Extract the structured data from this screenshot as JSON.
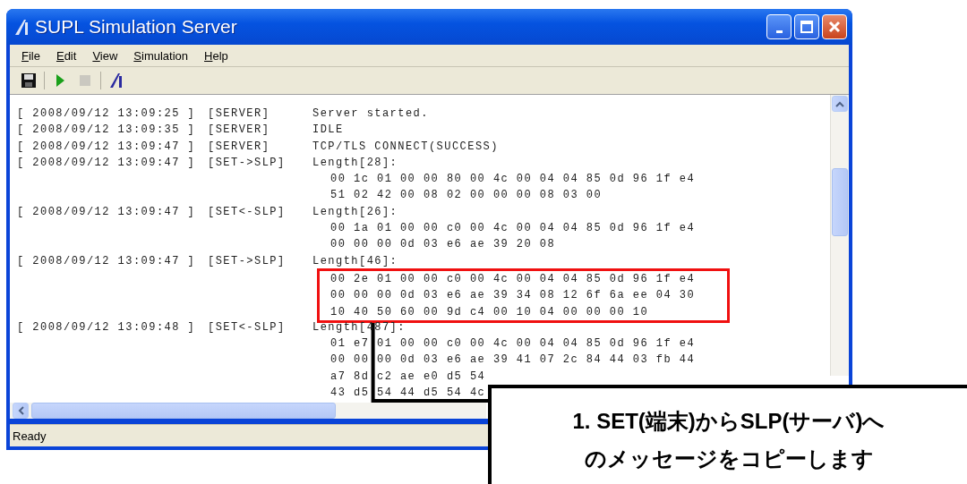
{
  "window": {
    "title": "SUPL Simulation Server"
  },
  "menu": [
    "File",
    "Edit",
    "View",
    "Simulation",
    "Help"
  ],
  "toolbar": [
    {
      "kind": "save",
      "disabled": false
    },
    {
      "kind": "separator"
    },
    {
      "kind": "play",
      "disabled": false
    },
    {
      "kind": "stop",
      "disabled": true
    },
    {
      "kind": "separator"
    },
    {
      "kind": "logo",
      "disabled": false
    }
  ],
  "log": [
    {
      "timestamp": "[ 2008/09/12 13:09:25 ]",
      "source": "[SERVER]",
      "message": "Server started."
    },
    {
      "timestamp": "[ 2008/09/12 13:09:35 ]",
      "source": "[SERVER]",
      "message": "IDLE"
    },
    {
      "timestamp": "[ 2008/09/12 13:09:47 ]",
      "source": "[SERVER]",
      "message": "TCP/TLS CONNECT(SUCCESS)"
    },
    {
      "timestamp": "[ 2008/09/12 13:09:47 ]",
      "source": "[SET->SLP]",
      "message": "Length[28]:",
      "highlighted": false,
      "data": [
        "00 1c 01 00 00 80 00 4c 00 04 04 85 0d 96 1f e4",
        "51 02 42 00 08 02 00 00 00 08 03 00"
      ]
    },
    {
      "timestamp": "[ 2008/09/12 13:09:47 ]",
      "source": "[SET<-SLP]",
      "message": "Length[26]:",
      "highlighted": false,
      "data": [
        "00 1a 01 00 00 c0 00 4c 00 04 04 85 0d 96 1f e4",
        "00 00 00 0d 03 e6 ae 39 20 08"
      ]
    },
    {
      "timestamp": "[ 2008/09/12 13:09:47 ]",
      "source": "[SET->SLP]",
      "message": "Length[46]:",
      "highlighted": true,
      "data": [
        "00 2e 01 00 00 c0 00 4c 00 04 04 85 0d 96 1f e4",
        "00 00 00 0d 03 e6 ae 39 34 08 12 6f 6a ee 04 30",
        "10 40 50 60 00 9d c4 00 10 04 00 00 00 10"
      ]
    },
    {
      "timestamp": "[ 2008/09/12 13:09:48 ]",
      "source": "[SET<-SLP]",
      "message": "Length[487]:",
      "highlighted": false,
      "data": [
        "01 e7 01 00 00 c0 00 4c 00 04 04 85 0d 96 1f e4",
        "00 00 00 0d 03 e6 ae 39 41 07 2c 84 44 03 fb 44",
        "a7 8d c2 ae e0 d5 54",
        "43 d5 54 44 d5 54 4c"
      ]
    }
  ],
  "status_bar": "Ready",
  "callout": {
    "lines": [
      "1. SET(端末)からSLP(サーバ)へ",
      "のメッセージをコピーします"
    ]
  }
}
